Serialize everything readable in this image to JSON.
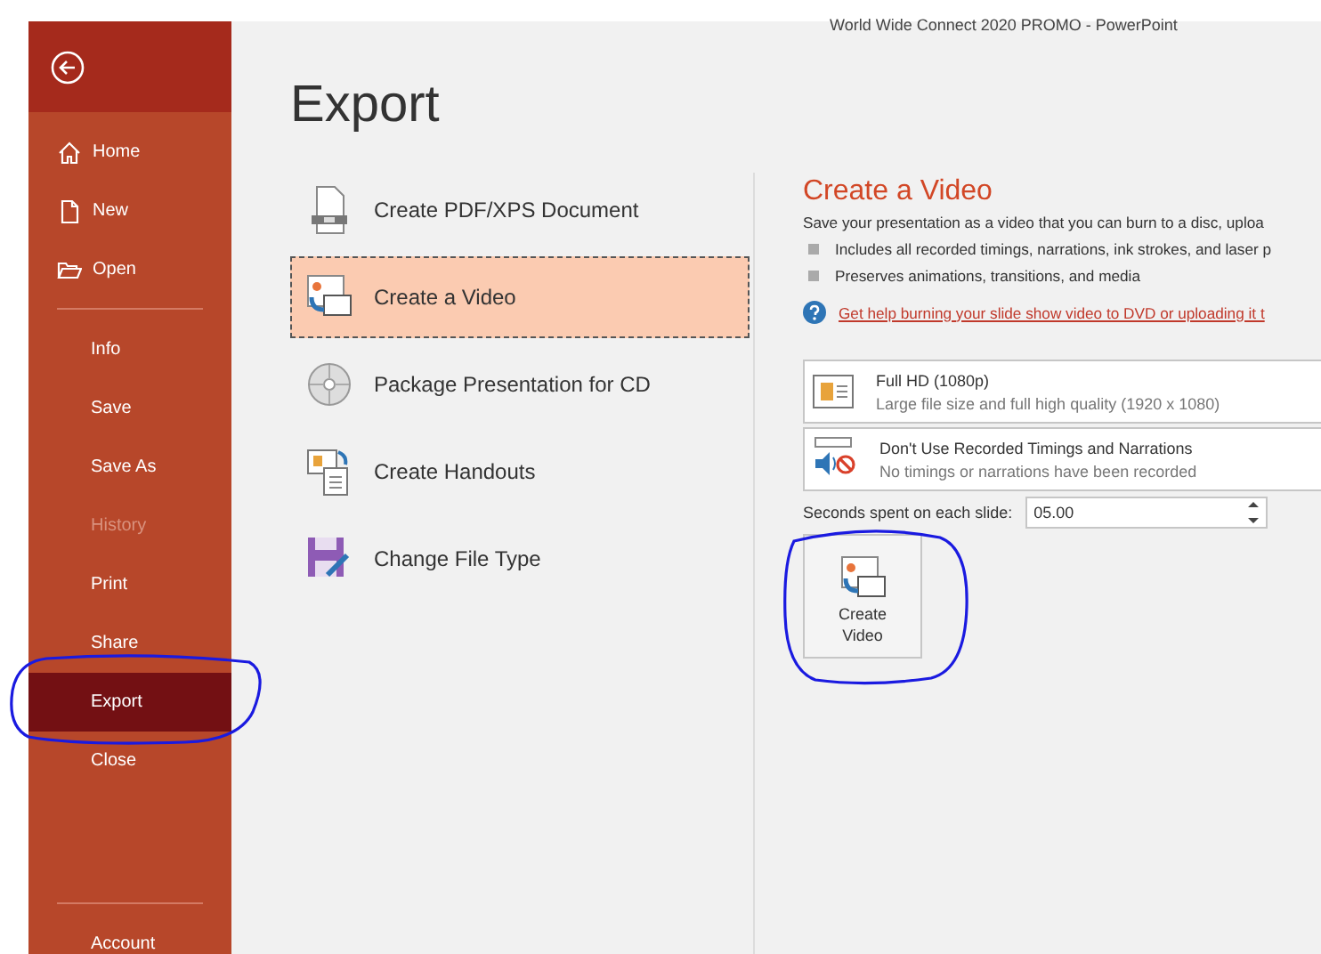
{
  "window": {
    "title": "World Wide Connect 2020 PROMO  -  PowerPoint"
  },
  "sidebar": {
    "top_items": [
      {
        "label": "Home",
        "kind": "home"
      },
      {
        "label": "New",
        "kind": "new"
      },
      {
        "label": "Open",
        "kind": "open"
      }
    ],
    "items": [
      {
        "label": "Info",
        "selected": false,
        "disabled": false
      },
      {
        "label": "Save",
        "selected": false,
        "disabled": false
      },
      {
        "label": "Save As",
        "selected": false,
        "disabled": false
      },
      {
        "label": "History",
        "selected": false,
        "disabled": true
      },
      {
        "label": "Print",
        "selected": false,
        "disabled": false
      },
      {
        "label": "Share",
        "selected": false,
        "disabled": false
      },
      {
        "label": "Export",
        "selected": true,
        "disabled": false
      },
      {
        "label": "Close",
        "selected": false,
        "disabled": false
      }
    ],
    "bottom_items": [
      {
        "label": "Account"
      }
    ]
  },
  "page_title": "Export",
  "options": [
    {
      "label": "Create PDF/XPS Document",
      "kind": "pdf",
      "selected": false
    },
    {
      "label": "Create a Video",
      "kind": "video",
      "selected": true
    },
    {
      "label": "Package Presentation for CD",
      "kind": "cd",
      "selected": false
    },
    {
      "label": "Create Handouts",
      "kind": "handouts",
      "selected": false
    },
    {
      "label": "Change File Type",
      "kind": "filetype",
      "selected": false
    }
  ],
  "panel": {
    "heading": "Create a Video",
    "description": "Save your presentation as a video that you can burn to a disc, uploa",
    "bullets": [
      "Includes all recorded timings, narrations, ink strokes, and laser p",
      "Preserves animations, transitions, and media"
    ],
    "help_link": "Get help burning your slide show video to DVD or uploading it t",
    "settings": [
      {
        "kind": "quality",
        "title": "Full HD (1080p)",
        "subtitle": "Large file size and full high quality (1920 x 1080)"
      },
      {
        "kind": "timings",
        "title": "Don't Use Recorded Timings and Narrations",
        "subtitle": "No timings or narrations have been recorded"
      }
    ],
    "seconds": {
      "label": "Seconds spent on each slide:",
      "value": "05.00"
    },
    "button": "Create Video"
  }
}
